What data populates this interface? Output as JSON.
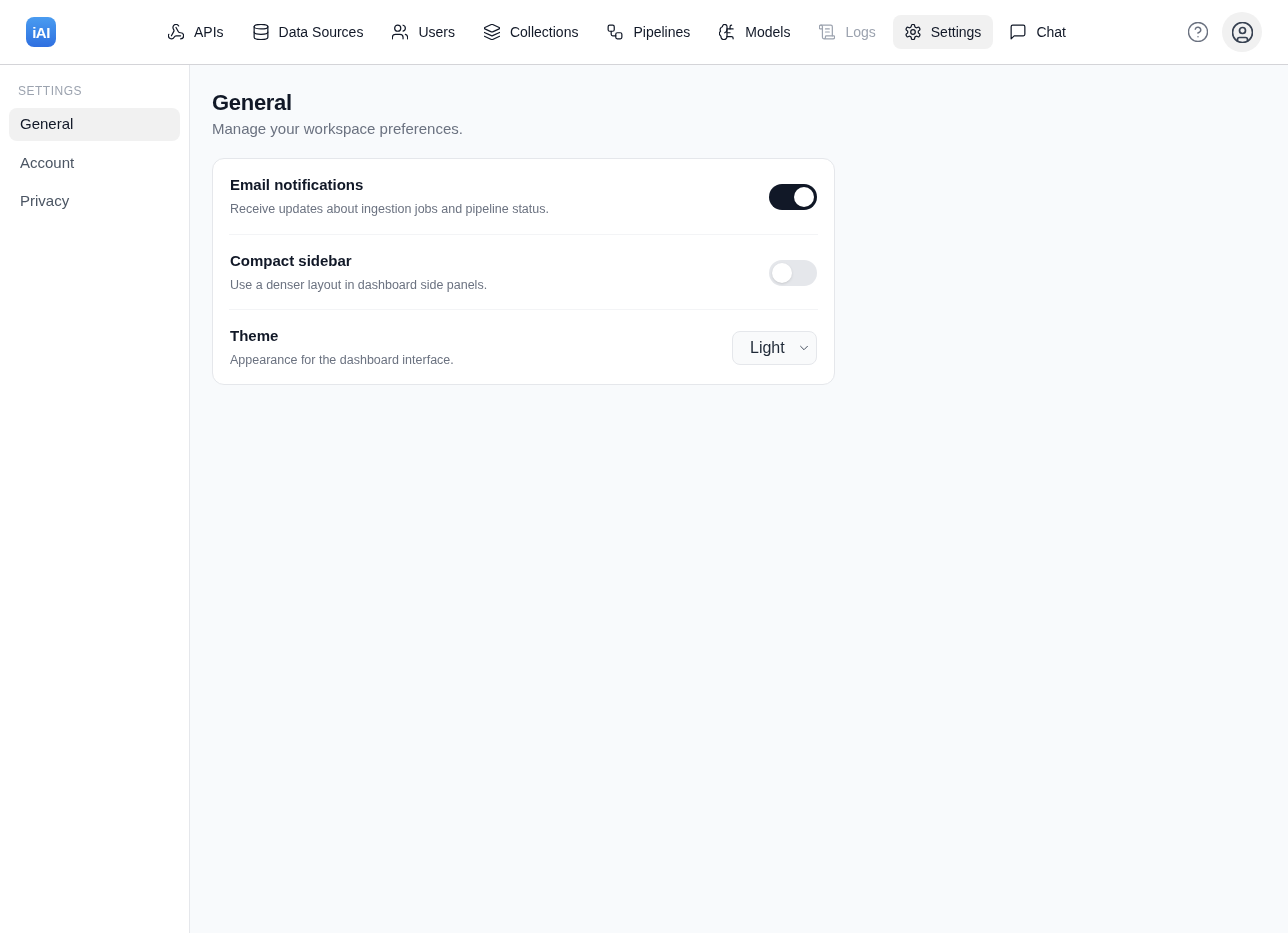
{
  "brand": {
    "logo_text": "iAI"
  },
  "nav": [
    {
      "label": "APIs",
      "selected": false,
      "disabled": false
    },
    {
      "label": "Data Sources",
      "selected": false,
      "disabled": false
    },
    {
      "label": "Users",
      "selected": false,
      "disabled": false
    },
    {
      "label": "Collections",
      "selected": false,
      "disabled": false
    },
    {
      "label": "Pipelines",
      "selected": false,
      "disabled": false
    },
    {
      "label": "Models",
      "selected": false,
      "disabled": false
    },
    {
      "label": "Logs",
      "selected": false,
      "disabled": true
    },
    {
      "label": "Settings",
      "selected": true,
      "disabled": false
    },
    {
      "label": "Chat",
      "selected": false,
      "disabled": false
    }
  ],
  "sidebar": {
    "heading": "SETTINGS",
    "items": [
      {
        "label": "General",
        "selected": true
      },
      {
        "label": "Account",
        "selected": false
      },
      {
        "label": "Privacy",
        "selected": false
      }
    ]
  },
  "page": {
    "title": "General",
    "subtitle": "Manage your workspace preferences."
  },
  "settings": [
    {
      "kind": "toggle",
      "title": "Email notifications",
      "description": "Receive updates about ingestion jobs and pipeline status.",
      "on": true
    },
    {
      "kind": "toggle",
      "title": "Compact sidebar",
      "description": "Use a denser layout in dashboard side panels.",
      "on": false
    },
    {
      "kind": "select",
      "title": "Theme",
      "description": "Appearance for the dashboard interface.",
      "value": "Light"
    }
  ]
}
